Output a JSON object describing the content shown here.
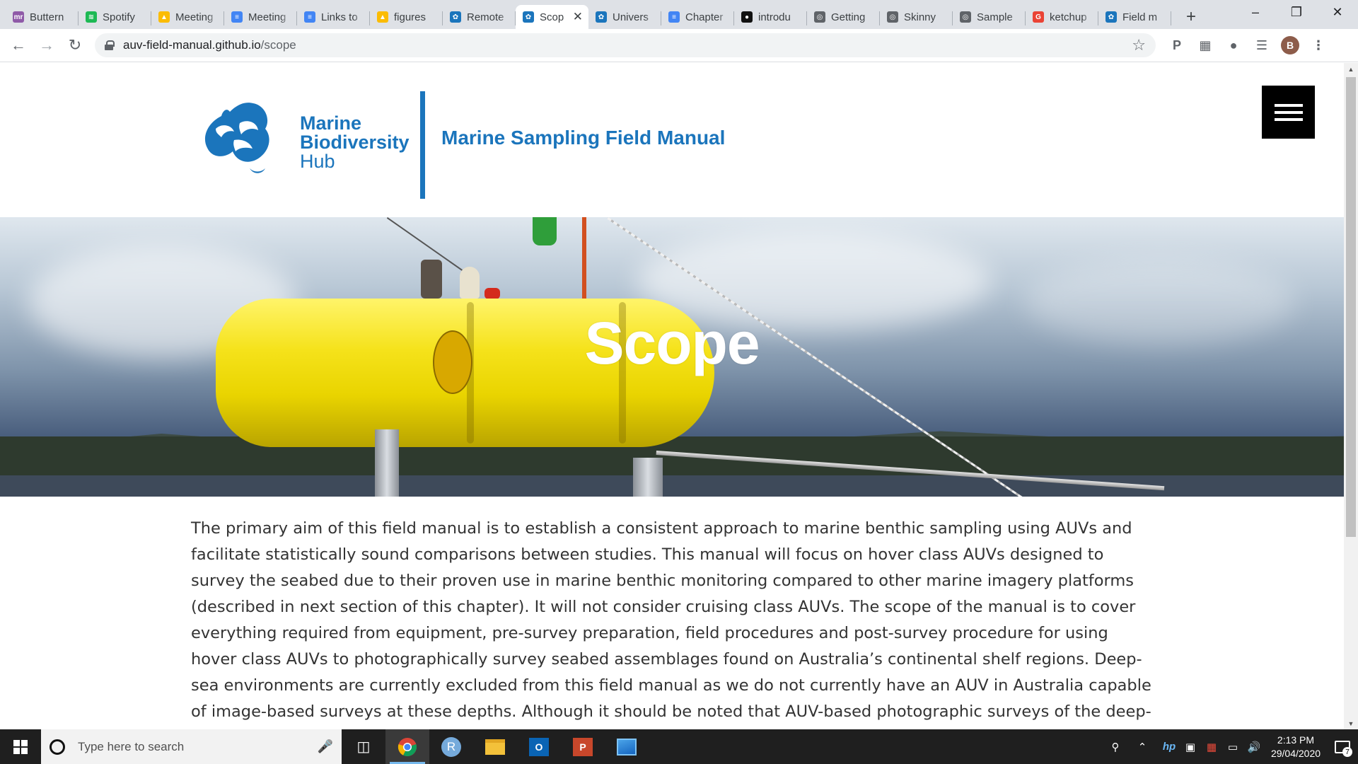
{
  "browser": {
    "tabs": [
      {
        "title": "Buttern",
        "favicon": "mr-icon",
        "color": "#8f5aa8",
        "glyph": "mr"
      },
      {
        "title": "Spotify",
        "favicon": "spotify-icon",
        "color": "#1db954",
        "glyph": "≋"
      },
      {
        "title": "Meeting",
        "favicon": "google-drive-icon",
        "color": "#fbbc04",
        "glyph": "▲"
      },
      {
        "title": "Meeting",
        "favicon": "google-docs-icon",
        "color": "#4285f4",
        "glyph": "≡"
      },
      {
        "title": "Links to",
        "favicon": "google-docs-icon",
        "color": "#4285f4",
        "glyph": "≡"
      },
      {
        "title": "figures",
        "favicon": "google-drive-icon",
        "color": "#fbbc04",
        "glyph": "▲"
      },
      {
        "title": "Remote",
        "favicon": "marine-hub-icon",
        "color": "#1b75bc",
        "glyph": "✿"
      },
      {
        "title": "Scop",
        "favicon": "marine-hub-icon",
        "color": "#1b75bc",
        "glyph": "✿",
        "active": true
      },
      {
        "title": "Univers",
        "favicon": "marine-hub-icon",
        "color": "#1b75bc",
        "glyph": "✿"
      },
      {
        "title": "Chapter",
        "favicon": "google-docs-icon",
        "color": "#4285f4",
        "glyph": "≡"
      },
      {
        "title": "introdu",
        "favicon": "github-icon",
        "color": "#111111",
        "glyph": "●"
      },
      {
        "title": "Getting",
        "favicon": "globe-icon",
        "color": "#5f6368",
        "glyph": "◎"
      },
      {
        "title": "Skinny",
        "favicon": "globe-icon",
        "color": "#5f6368",
        "glyph": "◎"
      },
      {
        "title": "Sample",
        "favicon": "globe-icon",
        "color": "#5f6368",
        "glyph": "◎"
      },
      {
        "title": "ketchup",
        "favicon": "google-icon",
        "color": "#ea4335",
        "glyph": "G"
      },
      {
        "title": "Field m",
        "favicon": "marine-hub-icon",
        "color": "#1b75bc",
        "glyph": "✿"
      }
    ],
    "url_host": "auv-field-manual.github.io",
    "url_path": "/scope",
    "profile_initial": "B",
    "new_tab_symbol": "+"
  },
  "site": {
    "logo_line1": "Marine",
    "logo_line2": "Biodiversity",
    "logo_line3": "Hub",
    "title": "Marine Sampling Field Manual",
    "brand_color": "#1b75bc"
  },
  "hero": {
    "title": "Scope"
  },
  "content": {
    "paragraph": "The primary aim of this field manual is to establish a consistent approach to marine benthic sampling using AUVs and facilitate statistically sound comparisons between studies. This manual will focus on hover class AUVs designed to survey the seabed due to their proven use in marine benthic monitoring compared to other marine imagery platforms (described in next section of this chapter). It will not consider cruising class AUVs. The scope of the manual is to cover everything required from equipment, pre-survey preparation, field procedures and post-survey procedure for using hover class AUVs to photographically survey seabed assemblages found on Australia’s continental shelf regions. Deep-sea environments are currently excluded from this field manual as we do not currently have an AUV in Australia capable of image-based surveys at these depths. Although it should be noted that AUV-based photographic surveys of the deep-sea benthos have been"
  },
  "taskbar": {
    "search_placeholder": "Type here to search",
    "time": "2:13 PM",
    "date": "29/04/2020",
    "notification_count": "7"
  }
}
